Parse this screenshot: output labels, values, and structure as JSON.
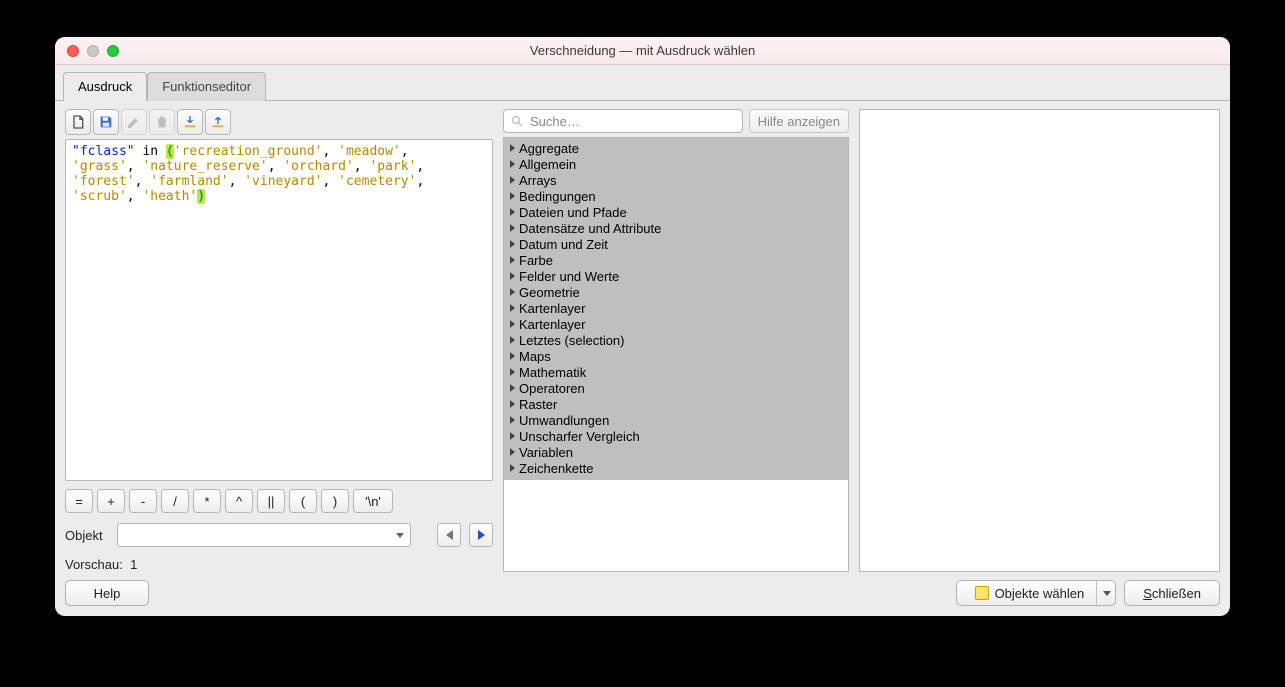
{
  "window": {
    "title": "Verschneidung — mit Ausdruck wählen"
  },
  "tabs": [
    {
      "label": "Ausdruck",
      "active": true
    },
    {
      "label": "Funktionseditor",
      "active": false
    }
  ],
  "expression": {
    "tokens": [
      {
        "t": "field",
        "v": "\"fclass\""
      },
      {
        "t": "sp",
        "v": " "
      },
      {
        "t": "kw",
        "v": "in"
      },
      {
        "t": "sp",
        "v": " "
      },
      {
        "t": "paren_hl",
        "v": "("
      },
      {
        "t": "str",
        "v": "'recreation_ground'"
      },
      {
        "t": "punc",
        "v": ", "
      },
      {
        "t": "str",
        "v": "'meadow'"
      },
      {
        "t": "punc",
        "v": ","
      },
      {
        "t": "br"
      },
      {
        "t": "str",
        "v": "'grass'"
      },
      {
        "t": "punc",
        "v": ", "
      },
      {
        "t": "str",
        "v": "'nature_reserve'"
      },
      {
        "t": "punc",
        "v": ", "
      },
      {
        "t": "str",
        "v": "'orchard'"
      },
      {
        "t": "punc",
        "v": ", "
      },
      {
        "t": "str",
        "v": "'park'"
      },
      {
        "t": "punc",
        "v": ","
      },
      {
        "t": "br"
      },
      {
        "t": "str",
        "v": "'forest'"
      },
      {
        "t": "punc",
        "v": ", "
      },
      {
        "t": "str",
        "v": "'farmland'"
      },
      {
        "t": "punc",
        "v": ", "
      },
      {
        "t": "str",
        "v": "'vineyard'"
      },
      {
        "t": "punc",
        "v": ", "
      },
      {
        "t": "str",
        "v": "'cemetery'"
      },
      {
        "t": "punc",
        "v": ","
      },
      {
        "t": "br"
      },
      {
        "t": "str",
        "v": "'scrub'"
      },
      {
        "t": "punc",
        "v": ", "
      },
      {
        "t": "str",
        "v": "'heath'"
      },
      {
        "t": "paren_hl",
        "v": ")"
      }
    ]
  },
  "operators": [
    "=",
    "+",
    "-",
    "/",
    "*",
    "^",
    "||",
    "(",
    ")",
    "'\\n'"
  ],
  "object": {
    "label": "Objekt",
    "value": ""
  },
  "preview": {
    "label": "Vorschau:",
    "value": "1"
  },
  "search": {
    "placeholder": "Suche…"
  },
  "help_hint": "Hilfe anzeigen",
  "tree": [
    "Aggregate",
    "Allgemein",
    "Arrays",
    "Bedingungen",
    "Dateien und Pfade",
    "Datensätze und Attribute",
    "Datum und Zeit",
    "Farbe",
    "Felder und Werte",
    "Geometrie",
    "Kartenlayer",
    "Kartenlayer",
    "Letztes (selection)",
    "Maps",
    "Mathematik",
    "Operatoren",
    "Raster",
    "Umwandlungen",
    "Unscharfer Vergleich",
    "Variablen",
    "Zeichenkette"
  ],
  "footer": {
    "help": "Help",
    "select_objects": "Objekte wählen",
    "close": "Schließen"
  }
}
